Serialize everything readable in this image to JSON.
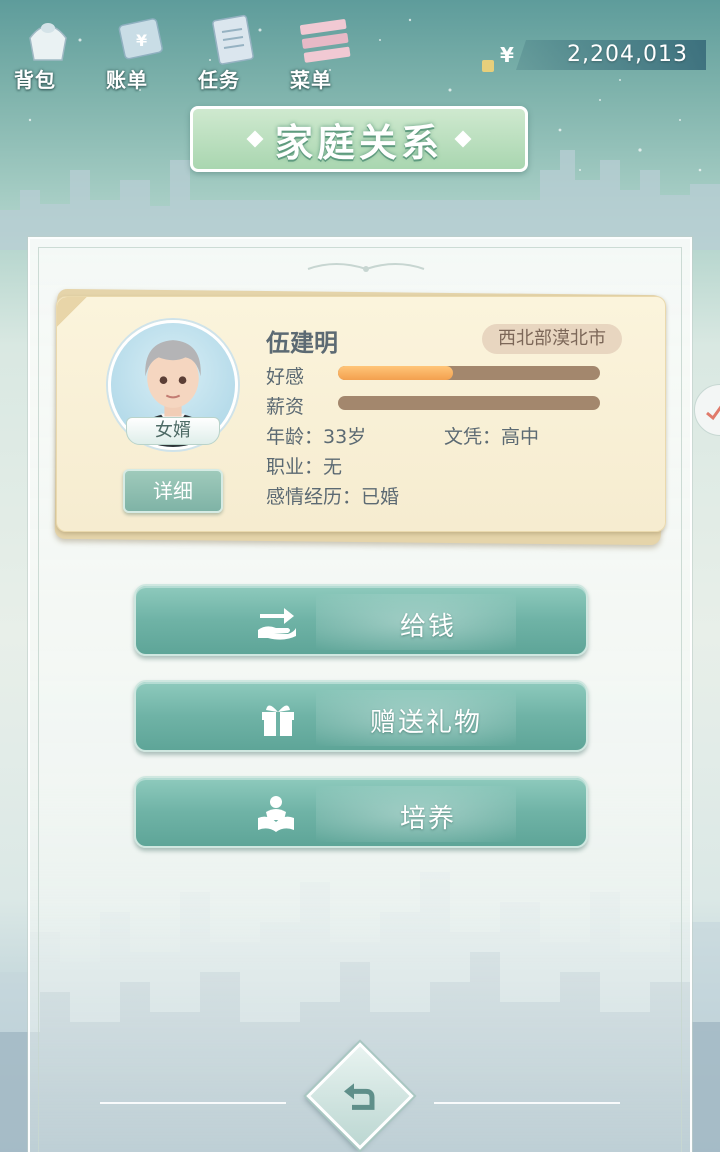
{
  "nav": [
    {
      "label": "背包",
      "icon": "bag-icon"
    },
    {
      "label": "账单",
      "icon": "bill-icon"
    },
    {
      "label": "任务",
      "icon": "task-icon"
    },
    {
      "label": "菜单",
      "icon": "menu-icon"
    }
  ],
  "money": {
    "currency_symbol": "¥",
    "amount": "2,204,013"
  },
  "title": "家庭关系",
  "character": {
    "name": "伍建明",
    "location": "西北部漠北市",
    "relation": "女婿",
    "detail_label": "详细",
    "favor_label": "好感",
    "favor_value": 0.44,
    "salary_label": "薪资",
    "salary_value": 0.0,
    "age_text": "年龄：33岁",
    "education_text": "文凭：高中",
    "job_text": "职业：无",
    "relationship_text": "感情经历：已婚"
  },
  "actions": [
    {
      "label": "给钱",
      "icon": "transfer-money-icon"
    },
    {
      "label": "赠送礼物",
      "icon": "gift-icon"
    },
    {
      "label": "培养",
      "icon": "reading-icon"
    }
  ],
  "colors": {
    "accent": "#6fb3a6",
    "favor_bar": "#f3a04f",
    "bar_track": "#a3876d",
    "card_bg": "#f6ecd0"
  }
}
